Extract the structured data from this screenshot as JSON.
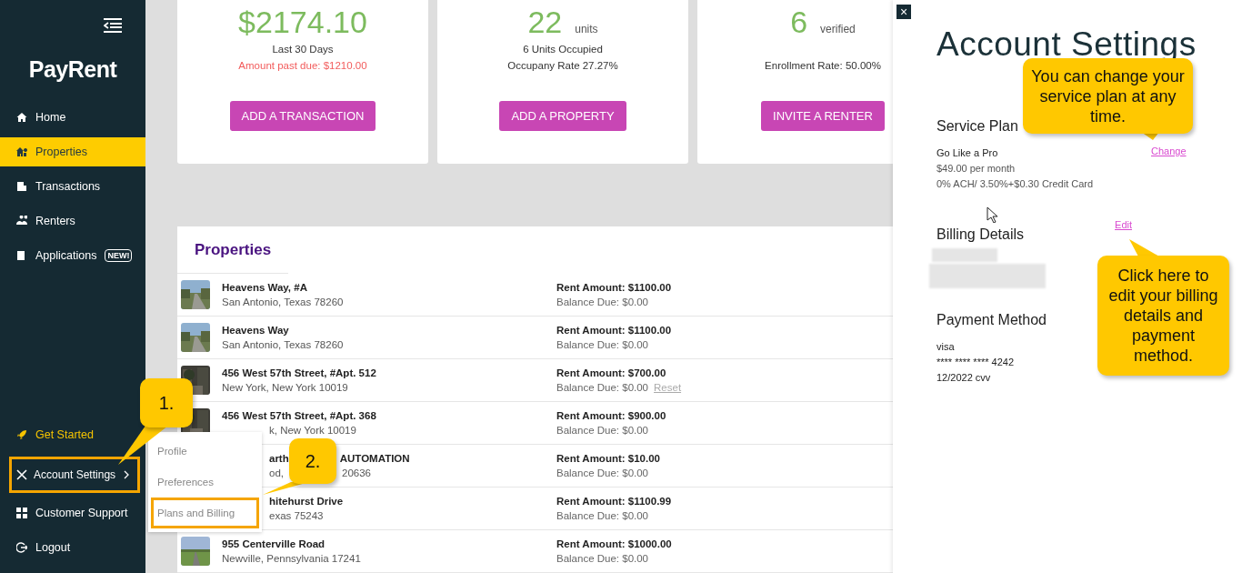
{
  "sidebar": {
    "logo": "PayRent",
    "items": [
      {
        "label": "Home",
        "selected": false
      },
      {
        "label": "Properties",
        "selected": true
      },
      {
        "label": "Transactions",
        "selected": false
      },
      {
        "label": "Renters",
        "selected": false
      },
      {
        "label": "Applications",
        "selected": false,
        "badge": "NEW!"
      }
    ],
    "bottom_items": [
      {
        "label": "Get Started",
        "accent": true,
        "highlighted": false,
        "expanded": false
      },
      {
        "label": "Account Settings",
        "accent": false,
        "highlighted": true,
        "expanded": true
      },
      {
        "label": "Customer Support",
        "accent": false,
        "highlighted": false,
        "expanded": false
      },
      {
        "label": "Logout",
        "accent": false,
        "highlighted": false,
        "expanded": false
      }
    ]
  },
  "stats": [
    {
      "value": "$2174.10",
      "line_1": "Last 30 Days",
      "line_2": "Amount past due: $1210.00",
      "line_2_alert": true,
      "button": "ADD A TRANSACTION"
    },
    {
      "value": "22",
      "unit": "units",
      "line_1": "6 Units Occupied",
      "line_2": "Occupany Rate 27.27%",
      "line_2_alert": false,
      "button": "ADD A PROPERTY"
    },
    {
      "value": "6",
      "unit": "verified",
      "line_2": "Enrollment Rate: 50.00%",
      "line_2_alert": false,
      "button": "INVITE A RENTER"
    }
  ],
  "properties": {
    "title": "Properties",
    "rows": [
      {
        "name": [
          "Heavens Way, #A"
        ],
        "city": [
          "San Antonio, Texas 78260"
        ],
        "rent": "Rent Amount: $1100.00",
        "balance": "Balance Due: $0.00"
      },
      {
        "name": [
          "Heavens Way"
        ],
        "city": [
          "San Antonio, Texas 78260"
        ],
        "rent": "Rent Amount: $1100.00",
        "balance": "Balance Due: $0.00"
      },
      {
        "name": [
          "456 West 57th Street, #Apt. 512"
        ],
        "city": [
          "New York, New York 10019"
        ],
        "rent": "Rent Amount: $700.00",
        "balance": "Balance Due: $0.00",
        "reset": "Reset"
      },
      {
        "name": [
          "456 West 57th Street, #Apt. 368"
        ],
        "city": [
          "k, New York 10019"
        ],
        "rent": "Rent Amount: $900.00",
        "balance": "Balance Due: $0.00"
      },
      {
        "name": [
          "arth",
          "AUTOMATION"
        ],
        "city": [
          "od,",
          "20636"
        ],
        "rent": "Rent Amount: $10.00",
        "balance": "Balance Due: $0.00"
      },
      {
        "name": [
          "hitehurst Drive"
        ],
        "city": [
          "exas 75243"
        ],
        "rent": "Rent Amount: $1100.99",
        "balance": "Balance Due: $0.00"
      },
      {
        "name": [
          "955 Centerville Road"
        ],
        "city": [
          "Newville, Pennsylvania 17241"
        ],
        "rent": "Rent Amount: $1000.00",
        "balance": "Balance Due: $0.00"
      }
    ]
  },
  "submenu": {
    "open": true,
    "items": [
      {
        "label": "Profile",
        "highlighted": false
      },
      {
        "label": "Preferences",
        "highlighted": false
      },
      {
        "label": "Plans and Billing",
        "highlighted": true
      }
    ]
  },
  "account_panel": {
    "close": "×",
    "title": "Account Settings",
    "service_plan": {
      "heading": "Service Plan",
      "lines": [
        "Go Like a Pro",
        "$49.00 per month",
        "0% ACH/ 3.50%+$0.30 Credit Card"
      ],
      "link": "Change"
    },
    "billing": {
      "heading": "Billing Details",
      "link": "Edit"
    },
    "payment": {
      "heading": "Payment Method",
      "lines": [
        "visa",
        "**** **** **** 4242",
        "12/2022 cvv"
      ]
    }
  },
  "callouts": [
    {
      "text": "1.",
      "kind": "step"
    },
    {
      "text": "2.",
      "kind": "step"
    },
    {
      "text": "You can change your service plan at any time.",
      "kind": "tip"
    },
    {
      "text": "Click here to edit your billing details and payment method.",
      "kind": "tip"
    }
  ]
}
